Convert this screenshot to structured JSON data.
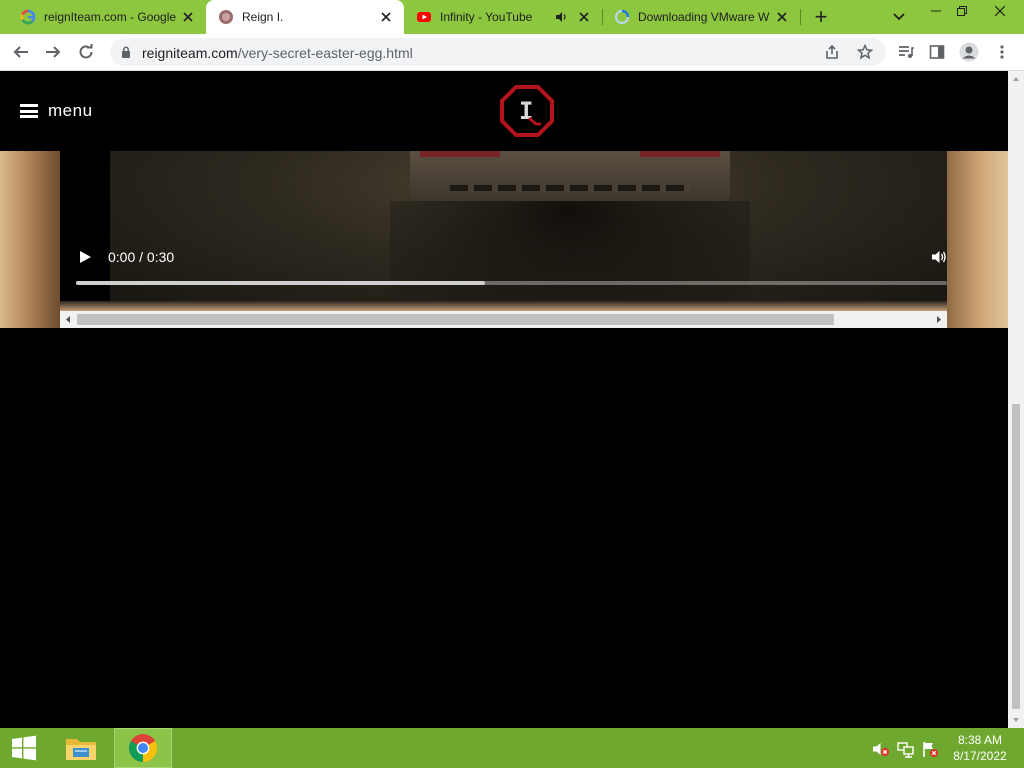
{
  "tabs": [
    {
      "title": "reignIteam.com - Google",
      "favicon": "google-g-icon",
      "close_label": "×",
      "active": false
    },
    {
      "title": "Reign I.",
      "favicon": "reign-favicon-icon",
      "close_label": "×",
      "active": true
    },
    {
      "title": "Infinity - YouTube",
      "favicon": "youtube-icon",
      "close_label": "×",
      "active": false,
      "audio": "speaker-icon"
    },
    {
      "title": "Downloading VMware W",
      "favicon": "loading-spinner-icon",
      "close_label": "×",
      "active": false
    }
  ],
  "tabstrip": {
    "new_tab": "+"
  },
  "address_bar": {
    "host": "reigniteam.com",
    "path": "/very-secret-easter-egg.html"
  },
  "site": {
    "menu_label": "menu",
    "logo_letter": "I"
  },
  "video": {
    "time": "0:00 / 0:30",
    "buffered_fraction": 0.47
  },
  "taskbar": {
    "time": "8:38 AM",
    "date": "8/17/2022"
  },
  "colors": {
    "tabstrip": "#8dc63f",
    "taskbar": "#6fa82f",
    "logo_red": "#b3141b"
  }
}
